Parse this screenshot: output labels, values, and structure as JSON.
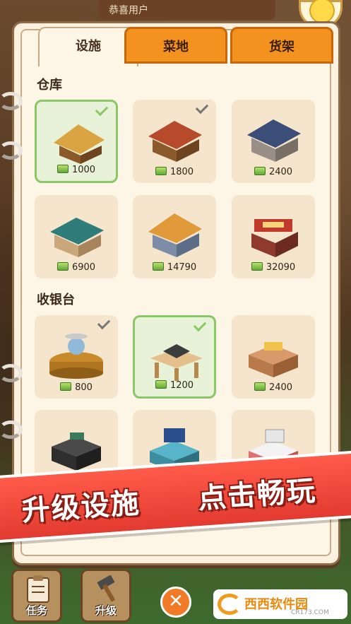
{
  "header": {
    "banner_text": "恭喜用户"
  },
  "tabs": [
    {
      "label": "设施",
      "active": true
    },
    {
      "label": "菜地",
      "active": false
    },
    {
      "label": "货架",
      "active": false
    }
  ],
  "sections": {
    "warehouse": {
      "title": "仓库",
      "items": [
        {
          "price": "1000",
          "state": "selected",
          "icon": "thatched-hut-icon"
        },
        {
          "price": "1800",
          "state": "owned",
          "icon": "wooden-house-icon"
        },
        {
          "price": "2400",
          "state": "none",
          "icon": "stone-house-icon"
        },
        {
          "price": "6900",
          "state": "none",
          "icon": "green-roof-house-icon"
        },
        {
          "price": "14790",
          "state": "none",
          "icon": "villa-icon"
        },
        {
          "price": "32090",
          "state": "none",
          "icon": "shop-building-icon"
        }
      ]
    },
    "cashier": {
      "title": "收银台",
      "items": [
        {
          "price": "800",
          "state": "owned",
          "icon": "scale-on-stump-icon"
        },
        {
          "price": "1200",
          "state": "selected",
          "icon": "scale-on-table-icon"
        },
        {
          "price": "2400",
          "state": "none",
          "icon": "counter-icon"
        },
        {
          "state": "none",
          "icon": "dark-register-icon"
        },
        {
          "state": "none",
          "icon": "laptop-register-icon"
        },
        {
          "state": "none",
          "icon": "white-register-icon"
        }
      ]
    }
  },
  "promo": {
    "left": "升级设施",
    "right": "点击畅玩"
  },
  "bottom_bar": {
    "task_label": "任务",
    "upgrade_label": "升级",
    "close_symbol": "✕"
  },
  "watermark": {
    "brand": "西西软件园",
    "url": "CR173.COM"
  },
  "colors": {
    "accent": "#f3921f",
    "selected": "#8bc667",
    "promo": "#e23a30"
  }
}
